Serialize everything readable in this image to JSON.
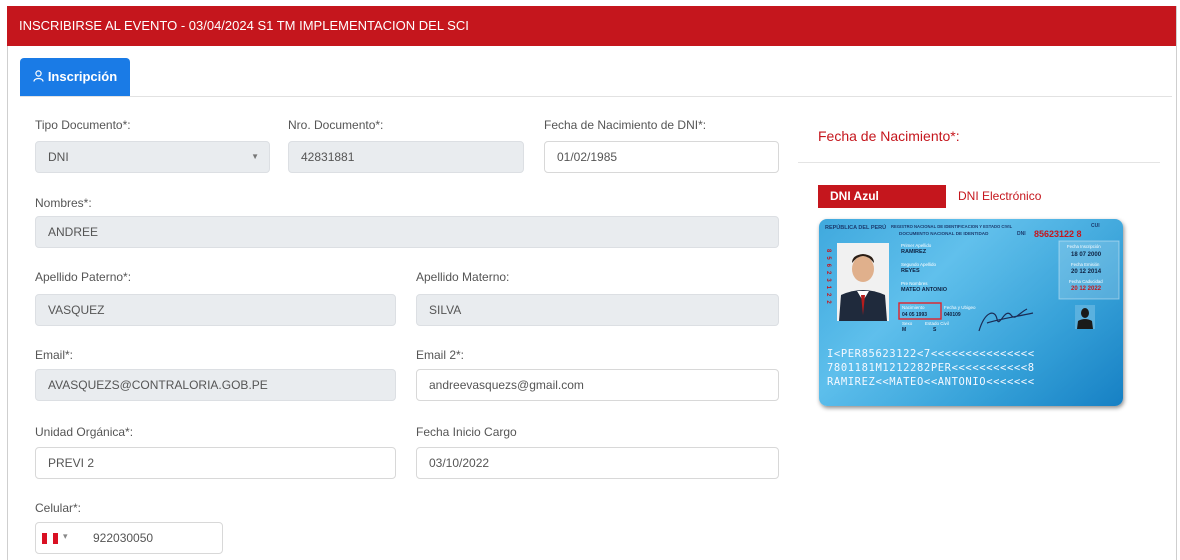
{
  "header": {
    "title": "INSCRIBIRSE AL EVENTO - 03/04/2024 S1 TM IMPLEMENTACION DEL SCI"
  },
  "tab": {
    "label": "Inscripción"
  },
  "form": {
    "tipo_documento": {
      "label": "Tipo Documento*:",
      "value": "DNI"
    },
    "nro_documento": {
      "label": "Nro. Documento*:",
      "value": "42831881"
    },
    "fecha_nacimiento_dni": {
      "label": "Fecha de Nacimiento de DNI*:",
      "value": "01/02/1985"
    },
    "nombres": {
      "label": "Nombres*:",
      "value": "ANDREE"
    },
    "apellido_paterno": {
      "label": "Apellido Paterno*:",
      "value": "VASQUEZ"
    },
    "apellido_materno": {
      "label": "Apellido Materno:",
      "value": "SILVA"
    },
    "email": {
      "label": "Email*:",
      "value": "AVASQUEZS@CONTRALORIA.GOB.PE"
    },
    "email2": {
      "label": "Email 2*:",
      "value": "andreevasquezs@gmail.com"
    },
    "unidad_organica": {
      "label": "Unidad Orgánica*:",
      "value": "PREVI 2"
    },
    "fecha_inicio_cargo": {
      "label": "Fecha Inicio Cargo",
      "value": "03/10/2022"
    },
    "celular": {
      "label": "Celular*:",
      "value": "922030050"
    }
  },
  "right": {
    "title": "Fecha de Nacimiento*:",
    "btn_dni_azul": "DNI Azul",
    "btn_dni_electronico": "DNI Electrónico"
  },
  "dni_card": {
    "republica": "REPÚBLICA DEL PERÚ",
    "registro": "REGISTRO NACIONAL DE IDENTIFICACION Y ESTADO CIVIL",
    "documento": "DOCUMENTO NACIONAL DE IDENTIDAD",
    "dni_label": "DNI",
    "cui_label": "CUI",
    "cui": "85623122 8",
    "primer_apellido_label": "Primer Apellido",
    "primer_apellido": "RAMIREZ",
    "segundo_apellido_label": "Segundo Apellido",
    "segundo_apellido": "REYES",
    "pre_nombres_label": "Pre Nombres",
    "pre_nombres": "MATEO ANTONIO",
    "nacimiento_label": "Nacimiento",
    "nacimiento": "04 05 1993",
    "ubigeo_label": "Fecha y Ubigeo",
    "ubigeo": "040109",
    "sexo_label": "Sexo",
    "sexo": "M",
    "estado_civil_label": "Estado Civil",
    "estado_civil": "S",
    "inscripcion_label": "Fecha Inscripción",
    "inscripcion": "18 07 2000",
    "emision_label": "Fecha Emisión",
    "emision": "20 12 2014",
    "caducidad_label": "Fecha Caducidad",
    "caducidad": "20 12 2022",
    "mrz1": "I<PER85623122<7<<<<<<<<<<<<<<<",
    "mrz2": "7801181M1212282PER<<<<<<<<<<<8",
    "mrz3": "RAMIREZ<<MATEO<<ANTONIO<<<<<<<"
  },
  "colors": {
    "brand_red": "#c5161d",
    "tab_blue": "#1a7be6",
    "disabled_bg": "#e9ecef",
    "flag_red": "#d91023"
  }
}
